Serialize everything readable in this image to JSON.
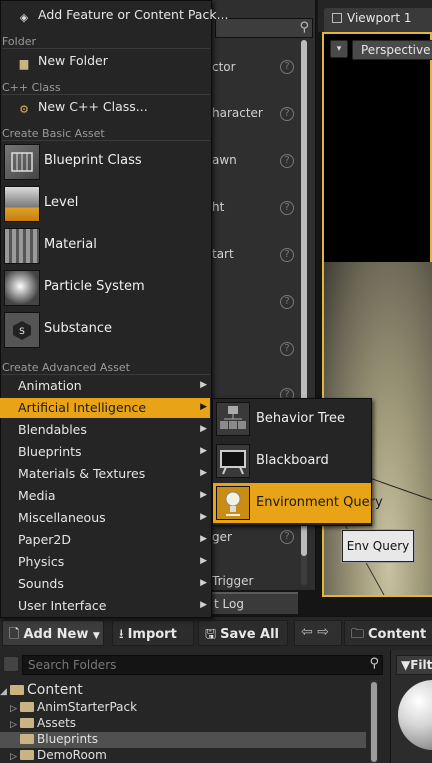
{
  "menu": {
    "top_items": [
      {
        "label": "Add Feature or Content Pack...",
        "icon": "cube-icon"
      }
    ],
    "sections": {
      "folder": "Folder",
      "cpp": "C++ Class",
      "basic": "Create Basic Asset",
      "advanced": "Create Advanced Asset"
    },
    "new_folder": "New Folder",
    "new_cpp": "New C++ Class...",
    "basic_assets": [
      {
        "label": "Blueprint Class"
      },
      {
        "label": "Level"
      },
      {
        "label": "Material"
      },
      {
        "label": "Particle System"
      },
      {
        "label": "Substance"
      }
    ],
    "advanced": [
      {
        "label": "Animation"
      },
      {
        "label": "Artificial Intelligence"
      },
      {
        "label": "Blendables"
      },
      {
        "label": "Blueprints"
      },
      {
        "label": "Materials & Textures"
      },
      {
        "label": "Media"
      },
      {
        "label": "Miscellaneous"
      },
      {
        "label": "Paper2D"
      },
      {
        "label": "Physics"
      },
      {
        "label": "Sounds"
      },
      {
        "label": "User Interface"
      }
    ],
    "highlight_color": "#e8a316"
  },
  "submenu": {
    "items": [
      {
        "label": "Behavior Tree"
      },
      {
        "label": "Blackboard"
      },
      {
        "label": "Environment Query"
      }
    ]
  },
  "tooltip": "Env Query",
  "place_actors": {
    "items": [
      "ctor",
      "haracter",
      "awn",
      "ht",
      "tart",
      "",
      "",
      "",
      "ger",
      "Trigger"
    ],
    "output_log_tab": "t Log"
  },
  "viewport": {
    "tab": "Viewport 1",
    "perspective": "Perspective"
  },
  "toolbar": {
    "add_new": "Add New",
    "import": "Import",
    "save_all": "Save All",
    "content": "Content"
  },
  "content_browser": {
    "search_placeholder": "Search Folders",
    "filters_label": "Filte",
    "tree": [
      {
        "label": "Content",
        "level": 0
      },
      {
        "label": "AnimStarterPack",
        "level": 1
      },
      {
        "label": "Assets",
        "level": 1
      },
      {
        "label": "Blueprints",
        "level": 1,
        "selected": true
      },
      {
        "label": "DemoRoom",
        "level": 1
      }
    ]
  }
}
